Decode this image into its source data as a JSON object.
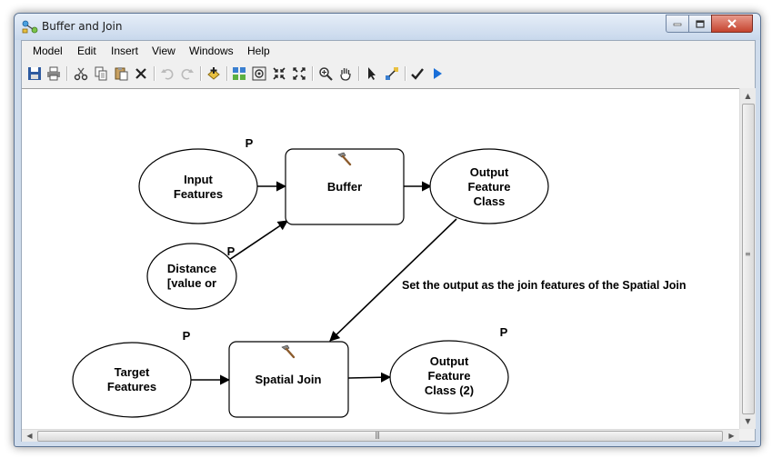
{
  "window": {
    "title": "Buffer and Join"
  },
  "menu": [
    "Model",
    "Edit",
    "Insert",
    "View",
    "Windows",
    "Help"
  ],
  "toolbar": {
    "icons": [
      "save-icon",
      "print-icon",
      "cut-icon",
      "copy-icon",
      "paste-icon",
      "delete-icon",
      "undo-icon",
      "redo-icon",
      "add-data-icon",
      "auto-layout-icon",
      "full-extent-icon",
      "zoom-in-fixed-icon",
      "zoom-out-fixed-icon",
      "zoom-icon",
      "pan-icon",
      "select-icon",
      "connect-icon",
      "validate-icon",
      "run-icon"
    ]
  },
  "diagram": {
    "nodes": {
      "input_features": [
        "Input",
        "Features"
      ],
      "buffer": "Buffer",
      "output_feature_class": [
        "Output",
        "Feature",
        "Class"
      ],
      "distance": [
        "Distance",
        "[value or"
      ],
      "target_features": [
        "Target",
        "Features"
      ],
      "spatial_join": "Spatial Join",
      "output_feature_class_2": [
        "Output",
        "Feature",
        "Class (2)"
      ]
    },
    "param_marker": "P",
    "annotation": "Set the output as the join features of the Spatial Join"
  },
  "colors": {
    "title_bar": "#c8d8ec",
    "close_button": "#c5442f",
    "run_arrow": "#1a6fd8"
  }
}
